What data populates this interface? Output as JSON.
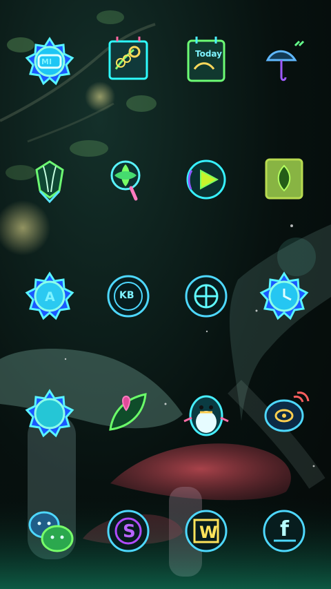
{
  "home_screen": {
    "apps": [
      {
        "icon": "mi-flower-icon",
        "text": "MI"
      },
      {
        "icon": "gallery-bouquet-icon",
        "text": ""
      },
      {
        "icon": "calendar-today-icon",
        "text": "Today"
      },
      {
        "icon": "weather-umbrella-icon",
        "text": ""
      },
      {
        "icon": "flower-bouquet-icon",
        "text": ""
      },
      {
        "icon": "search-clover-icon",
        "text": ""
      },
      {
        "icon": "play-button-icon",
        "text": ""
      },
      {
        "icon": "notes-leaf-icon",
        "text": ""
      },
      {
        "icon": "contacts-flower-icon",
        "text": "A"
      },
      {
        "icon": "kb-circle-icon",
        "text": "KB"
      },
      {
        "icon": "crosshair-circle-icon",
        "text": ""
      },
      {
        "icon": "clock-flower-icon",
        "text": ""
      },
      {
        "icon": "settings-flower-icon",
        "text": ""
      },
      {
        "icon": "maps-leaf-pin-icon",
        "text": ""
      },
      {
        "icon": "qq-penguin-icon",
        "text": ""
      },
      {
        "icon": "weibo-eye-icon",
        "text": ""
      },
      {
        "icon": "wechat-bubbles-icon",
        "text": ""
      },
      {
        "icon": "s-circle-icon",
        "text": "S"
      },
      {
        "icon": "w-circle-icon",
        "text": "W"
      },
      {
        "icon": "f-circle-icon",
        "text": "f"
      }
    ]
  },
  "colors": {
    "glow_cyan": "#59f4ff",
    "glow_green": "#62ff74",
    "glow_blue": "#3f7dff",
    "glow_purple": "#b04bff"
  }
}
